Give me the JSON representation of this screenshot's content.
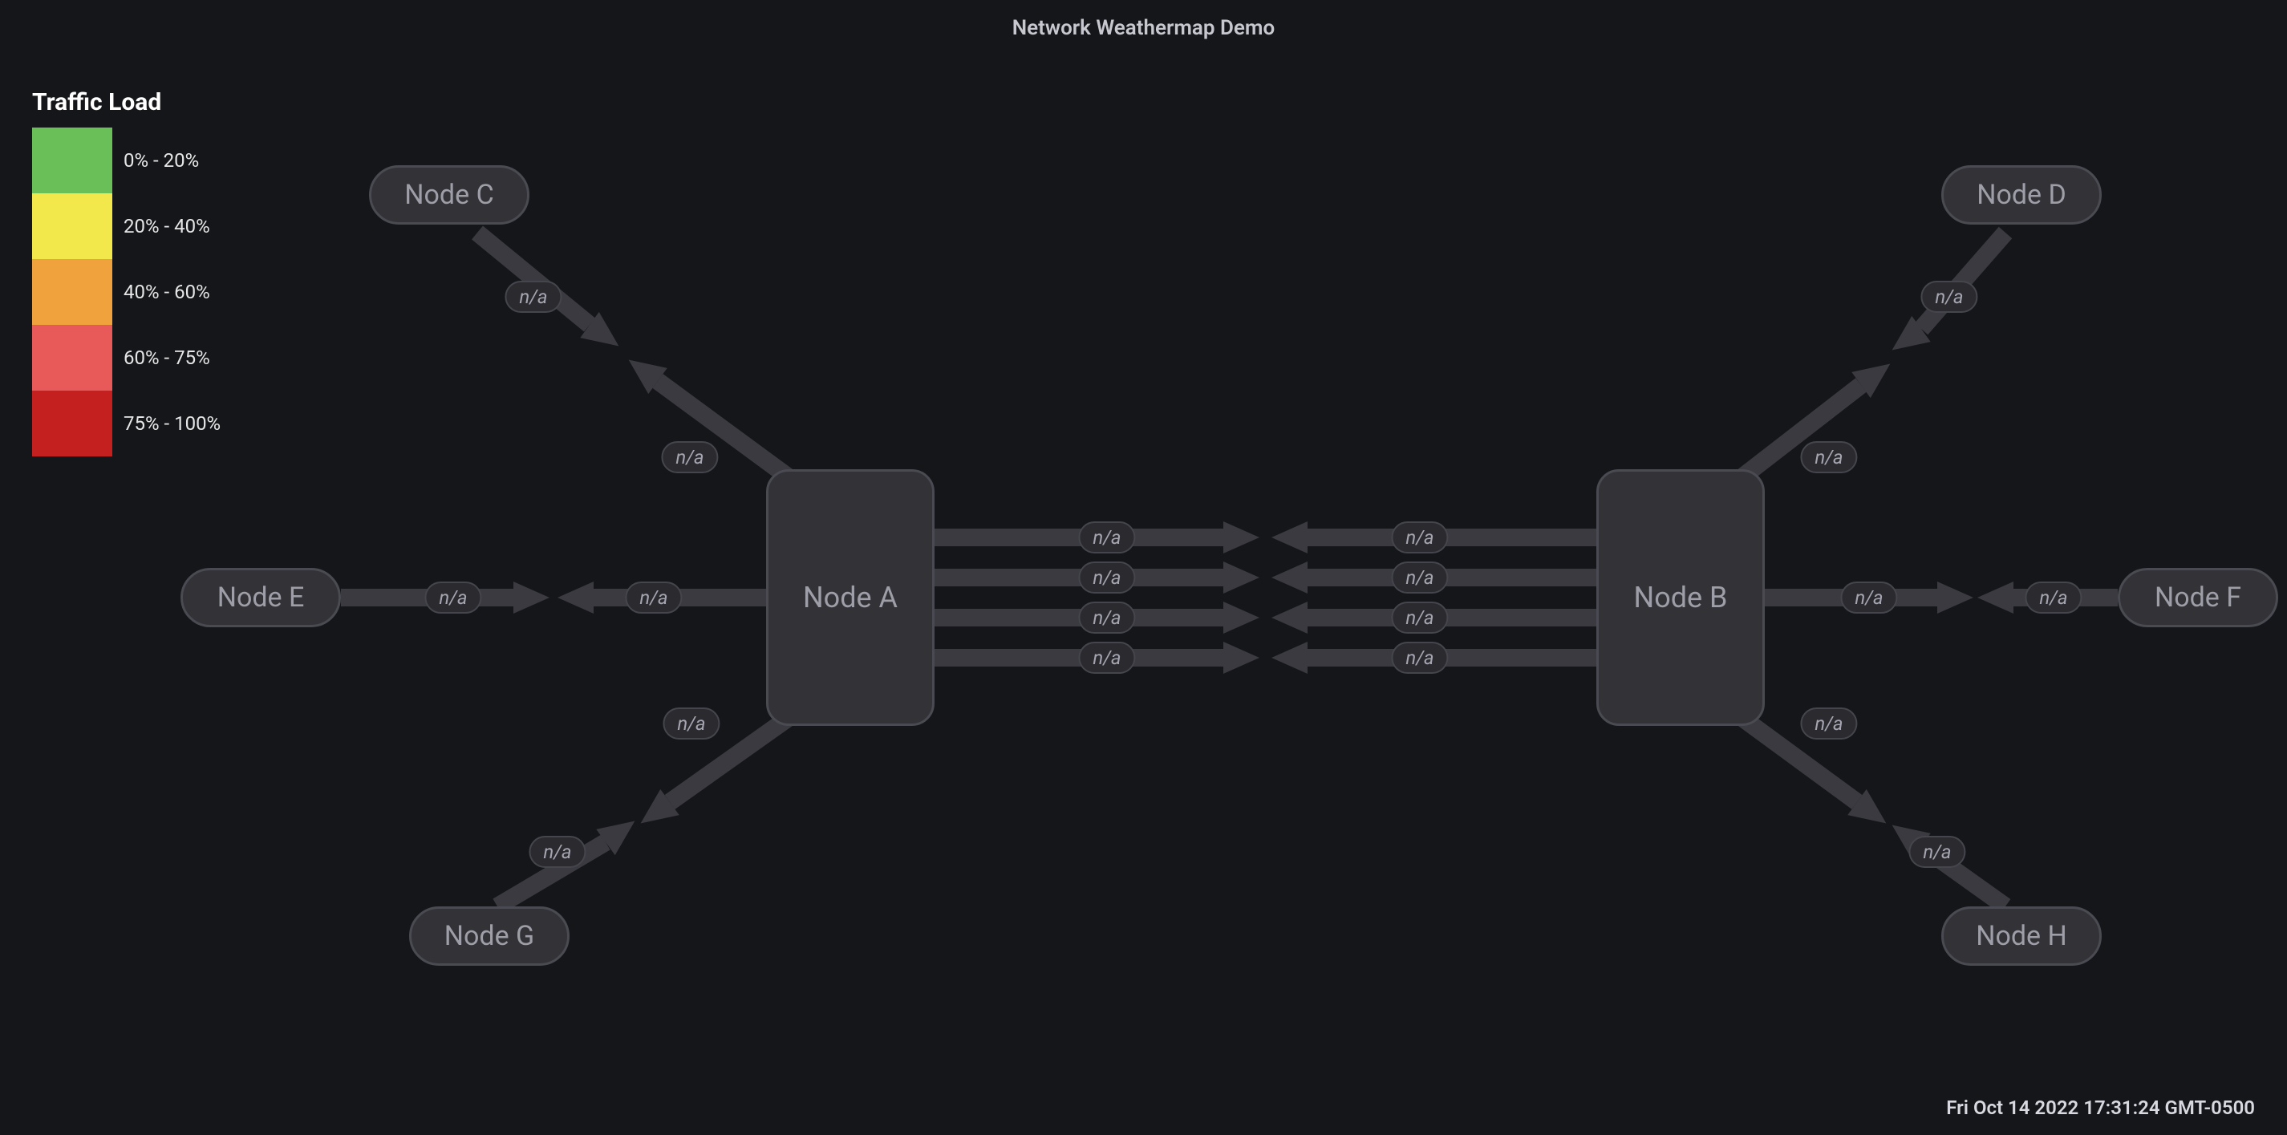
{
  "title": "Network Weathermap Demo",
  "legend": {
    "title": "Traffic Load",
    "buckets": [
      {
        "color": "#6bbf59",
        "label": "0% - 20%"
      },
      {
        "color": "#f2e84b",
        "label": "20% - 40%"
      },
      {
        "color": "#f0a33c",
        "label": "40% - 60%"
      },
      {
        "color": "#e85a5a",
        "label": "60% - 75%"
      },
      {
        "color": "#c42020",
        "label": "75% - 100%"
      }
    ]
  },
  "nodes": {
    "A": {
      "label": "Node A"
    },
    "B": {
      "label": "Node B"
    },
    "C": {
      "label": "Node C"
    },
    "D": {
      "label": "Node D"
    },
    "E": {
      "label": "Node E"
    },
    "F": {
      "label": "Node F"
    },
    "G": {
      "label": "Node G"
    },
    "H": {
      "label": "Node H"
    }
  },
  "link_value_default": "n/a",
  "links": {
    "ab1_a": "n/a",
    "ab1_b": "n/a",
    "ab2_a": "n/a",
    "ab2_b": "n/a",
    "ab3_a": "n/a",
    "ab3_b": "n/a",
    "ab4_a": "n/a",
    "ab4_b": "n/a",
    "ac_near": "n/a",
    "ac_far": "n/a",
    "ag_near": "n/a",
    "ag_far": "n/a",
    "ae_near": "n/a",
    "ae_far": "n/a",
    "bd_near": "n/a",
    "bd_far": "n/a",
    "bh_near": "n/a",
    "bh_far": "n/a",
    "bf_near": "n/a",
    "bf_far": "n/a"
  },
  "timestamp": "Fri Oct 14 2022 17:31:24 GMT-0500"
}
